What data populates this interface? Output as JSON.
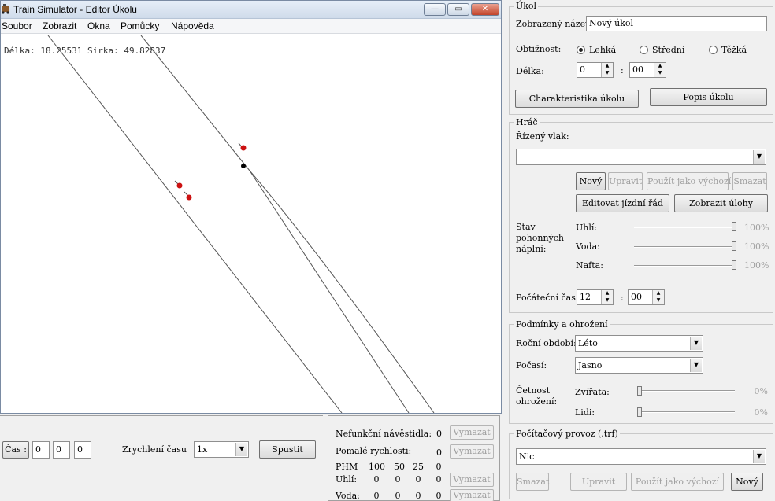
{
  "window": {
    "title": "Train Simulator - Editor Úkolu",
    "minimize": "—",
    "maximize": "▭",
    "close": "✕"
  },
  "menu": [
    "Soubor",
    "Zobrazit",
    "Okna",
    "Pomůcky",
    "Nápověda"
  ],
  "map": {
    "coords": "Délka: 18.25531 Sirka: 49.82837"
  },
  "time": {
    "label": "Čas :",
    "h": "0",
    "m": "0",
    "s": "0",
    "speed_label": "Zrychlení času",
    "speed_value": "1x",
    "start_button": "Spustit"
  },
  "stats": {
    "broken_signals_label": "Nefunkční návěstidla:",
    "broken_signals_value": "0",
    "slow_speeds_label": "Pomalé rychlosti:",
    "slow_speeds_value": "0",
    "clear_button": "Vymazat",
    "rows": [
      {
        "label": "PHM",
        "values": [
          "100",
          "50",
          "25",
          "0"
        ]
      },
      {
        "label": "Uhlí:",
        "values": [
          "0",
          "0",
          "0",
          "0"
        ]
      },
      {
        "label": "Voda:",
        "values": [
          "0",
          "0",
          "0",
          "0"
        ]
      }
    ]
  },
  "ukol": {
    "legend": "Úkol",
    "display_name_label": "Zobrazený název:",
    "display_name_value": "Nový úkol",
    "difficulty_label": "Obtižnost:",
    "difficulty_options": [
      "Lehká",
      "Střední",
      "Těžká"
    ],
    "difficulty_selected": "Lehká",
    "length_label": "Délka:",
    "length_h": "0",
    "length_m": "00",
    "colon": ":",
    "characteristics_button": "Charakteristika úkolu",
    "description_button": "Popis úkolu"
  },
  "hrac": {
    "legend": "Hráč",
    "train_label": "Řízený vlak:",
    "train_value": "",
    "new_button": "Nový",
    "edit_button": "Upravit",
    "use_default_button": "Použít jako výchozí",
    "delete_button": "Smazat",
    "edit_timetable_button": "Editovat jízdní řád",
    "show_tasks_button": "Zobrazit úlohy",
    "fuel_label": "Stav pohonných náplní:",
    "fuel": [
      {
        "label": "Uhlí:",
        "percent": 100,
        "text": "100%"
      },
      {
        "label": "Voda:",
        "percent": 100,
        "text": "100%"
      },
      {
        "label": "Nafta:",
        "percent": 100,
        "text": "100%"
      }
    ],
    "start_time_label": "Počáteční čas:",
    "start_h": "12",
    "start_m": "00"
  },
  "podminky": {
    "legend": "Podmínky a ohrožení",
    "season_label": "Roční období:",
    "season_value": "Léto",
    "weather_label": "Počasí:",
    "weather_value": "Jasno",
    "threat_label": "Četnost ohrožení:",
    "animals_label": "Zvířata:",
    "animals_percent": 0,
    "animals_text": "0%",
    "people_label": "Lidi:",
    "people_percent": 0,
    "people_text": "0%"
  },
  "provoz": {
    "legend": "Počítačový provoz (.trf)",
    "value": "Nic",
    "delete_button": "Smazat",
    "edit_button": "Upravit",
    "use_default_button": "Použít jako výchozí",
    "new_button": "Nový"
  },
  "colors": {
    "track_line": "#555555",
    "signal_red": "#cc1111",
    "signal_black": "#000000"
  }
}
